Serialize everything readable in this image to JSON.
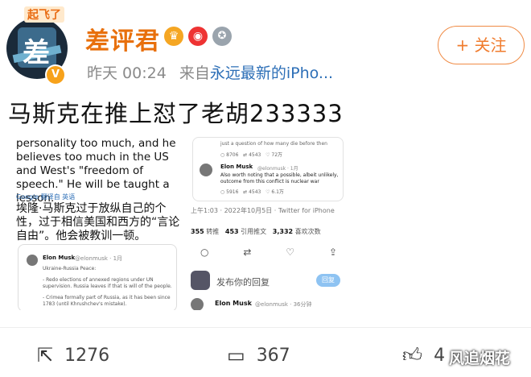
{
  "header": {
    "avatar_tag": "起飞了",
    "username": "差评君",
    "timestamp": "昨天 00:24",
    "source_prefix": "来自",
    "source": "永远最新的iPho...",
    "follow_label": "+ 关注"
  },
  "post": {
    "text": "马斯克在推上怼了老胡233333"
  },
  "left_shot": {
    "english": "personality too much, and he believes too much in the US and West's \"freedom of speech.\" He will be taught a lesson.",
    "translate": "Google 翻译自 英语",
    "chinese": "埃隆·马斯克过于放纵自己的个性，过于相信美国和西方的“言论自由”。他会被教训一顿。",
    "card": {
      "name": "Elon Musk",
      "handle": "@elonmusk · 1月",
      "line1": "Ukraine-Russia Peace:",
      "line2": "- Redo elections of annexed regions under UN",
      "line3": "supervision. Russia leaves if that is will of the people.",
      "line4": "- Crimea formally part of Russia, as it has been since",
      "line5": "1783 (until Khrushchev's mistake)."
    }
  },
  "right_shot": {
    "card_line0": "just a question of how many die before then",
    "card_stats1": [
      "8706",
      "4543",
      "72万"
    ],
    "name": "Elon Musk",
    "handle": "@elonmusk · 1月",
    "line1": "Also worth noting that a possible, albeit unlikely,",
    "line2": "outcome from this conflict is nuclear war",
    "card_stats2": [
      "5916",
      "4543",
      "6.1万"
    ],
    "date": "上午1:03 · 2022年10月5日 · Twitter for iPhone",
    "stats": [
      {
        "num": "355",
        "label": "转推"
      },
      {
        "num": "453",
        "label": "引用推文"
      },
      {
        "num": "3,332",
        "label": "喜欢次数"
      }
    ],
    "reply_placeholder": "发布你的回复",
    "reply_button": "回复",
    "reply2_name": "Elon Musk",
    "reply2_handle": "@elonmusk · 36分钟"
  },
  "actions": {
    "share_count": "1276",
    "comment_count": "367",
    "like_count": "4"
  },
  "watermark": "风追烟花",
  "colors": {
    "brand_orange": "#e8700c",
    "link_blue": "#2d6fb7"
  }
}
